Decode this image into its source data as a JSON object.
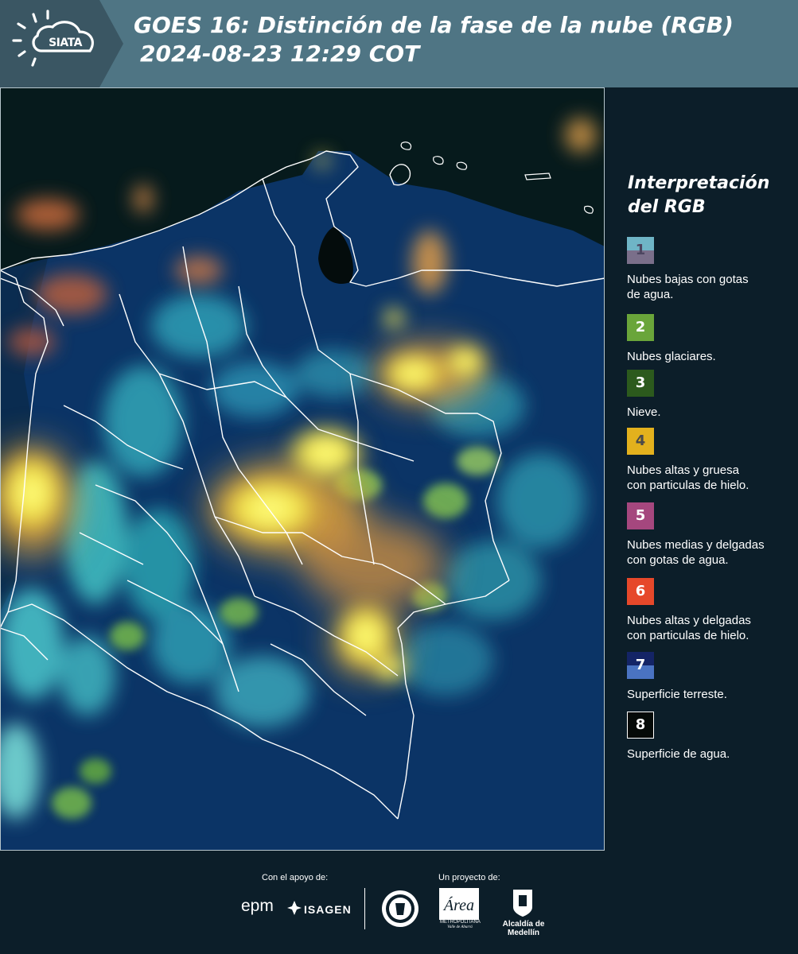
{
  "header": {
    "logo_text": "SIATA",
    "title_line1": "GOES 16: Distinción de la fase de la nube (RGB)",
    "title_line2": "2024-08-23 12:29 COT"
  },
  "map": {
    "product": "Distinción de la fase de la nube (RGB)",
    "satellite": "GOES 16",
    "region": "Colombia"
  },
  "legend": {
    "title_line1": "Interpretación",
    "title_line2": "del RGB",
    "items": [
      {
        "number": "1",
        "label_line1": "Nubes bajas con gotas",
        "label_line2": "de agua.",
        "color_top": "#6fb5c6",
        "color_bottom": "#7a6f8a",
        "num_color": "#4d4660"
      },
      {
        "number": "2",
        "label_line1": "Nubes glaciares.",
        "label_line2": "",
        "color_top": "#6aa53a",
        "color_bottom": "#6aa53a",
        "num_color": "#ffffff"
      },
      {
        "number": "3",
        "label_line1": "Nieve.",
        "label_line2": "",
        "color_top": "#2c5a1d",
        "color_bottom": "#2c5a1d",
        "num_color": "#ffffff"
      },
      {
        "number": "4",
        "label_line1": "Nubes altas y gruesa",
        "label_line2": "con particulas de hielo.",
        "color_top": "#e3b11d",
        "color_bottom": "#e3b11d",
        "num_color": "#4a4a4a"
      },
      {
        "number": "5",
        "label_line1": "Nubes medias y delgadas",
        "label_line2": "con gotas de agua.",
        "color_top": "#a5477e",
        "color_bottom": "#a5477e",
        "num_color": "#ffffff"
      },
      {
        "number": "6",
        "label_line1": "Nubes altas y delgadas",
        "label_line2": "con particulas de hielo.",
        "color_top": "#e6482a",
        "color_bottom": "#e6482a",
        "num_color": "#ffffff"
      },
      {
        "number": "7",
        "label_line1": "Superficie terreste.",
        "label_line2": "",
        "color_top": "#142466",
        "color_bottom": "#4a73c2",
        "num_color": "#ffffff"
      },
      {
        "number": "8",
        "label_line1": "Superficie de agua.",
        "label_line2": "",
        "color_top": "#050a08",
        "color_bottom": "#050a08",
        "num_color": "#ffffff"
      }
    ]
  },
  "footer": {
    "support_label": "Con el apoyo de:",
    "project_label": "Un proyecto de:",
    "epm": "epm",
    "isagen": "ISAGEN",
    "area_name": "METROPOLITANA",
    "area_sub": "Valle de Aburrá",
    "area_word": "Área",
    "alcaldia": "Alcaldía de Medellín"
  }
}
